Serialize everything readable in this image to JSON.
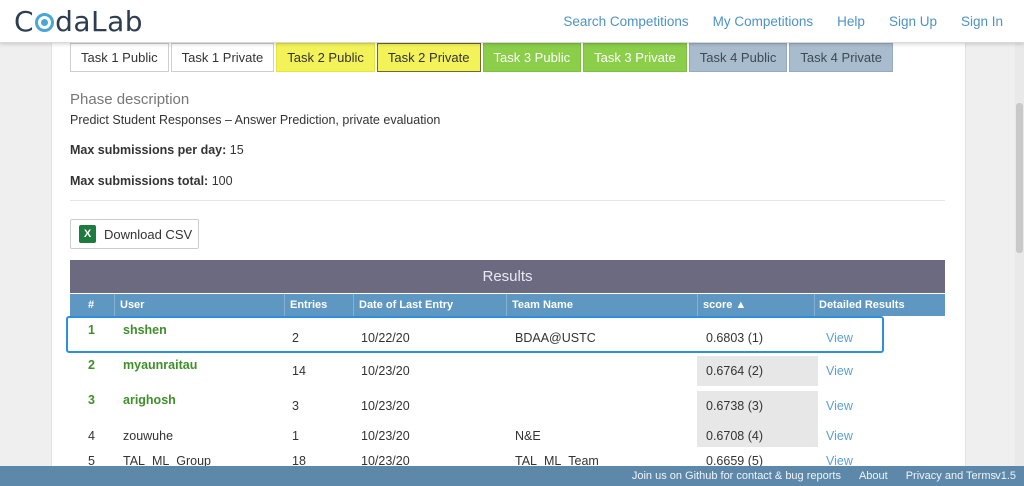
{
  "brand": {
    "name_prefix": "C",
    "name_suffix": "daLab"
  },
  "nav": [
    "Search Competitions",
    "My Competitions",
    "Help",
    "Sign Up",
    "Sign In"
  ],
  "tabs": [
    {
      "label": "Task 1 Public",
      "group": "t1"
    },
    {
      "label": "Task 1 Private",
      "group": "t1"
    },
    {
      "label": "Task 2 Public",
      "group": "t2"
    },
    {
      "label": "Task 2 Private",
      "group": "t2",
      "active": true
    },
    {
      "label": "Task 3 Public",
      "group": "t3"
    },
    {
      "label": "Task 3 Private",
      "group": "t3"
    },
    {
      "label": "Task 4 Public",
      "group": "t4"
    },
    {
      "label": "Task 4 Private",
      "group": "t4"
    }
  ],
  "phase": {
    "title": "Phase description",
    "description": "Predict Student Responses – Answer Prediction, private evaluation",
    "max_per_day_label": "Max submissions per day:",
    "max_per_day": "15",
    "max_total_label": "Max submissions total:",
    "max_total": "100"
  },
  "download": {
    "label": "Download CSV",
    "icon_letter": "X"
  },
  "results": {
    "title": "Results",
    "columns": [
      "#",
      "User",
      "Entries",
      "Date of Last Entry",
      "Team Name",
      "score ▲",
      "Detailed Results"
    ],
    "rows": [
      {
        "rank": "1",
        "user": "shshen",
        "entries": "2",
        "date": "10/22/20",
        "team": "BDAA@USTC",
        "score": "0.6803 (1)",
        "view": "View",
        "top": true
      },
      {
        "rank": "2",
        "user": "myaunraitau",
        "entries": "14",
        "date": "10/23/20",
        "team": "",
        "score": "0.6764 (2)",
        "view": "View",
        "top": true
      },
      {
        "rank": "3",
        "user": "arighosh",
        "entries": "3",
        "date": "10/23/20",
        "team": "",
        "score": "0.6738 (3)",
        "view": "View",
        "top": true
      },
      {
        "rank": "4",
        "user": "zouwuhe",
        "entries": "1",
        "date": "10/23/20",
        "team": "N&E",
        "score": "0.6708 (4)",
        "view": "View",
        "top": false
      },
      {
        "rank": "5",
        "user": "TAL_ML_Group",
        "entries": "18",
        "date": "10/23/20",
        "team": "TAL_ML_Team",
        "score": "0.6659 (5)",
        "view": "View",
        "top": false
      }
    ]
  },
  "footer": {
    "links": [
      "Join us on Github for contact & bug reports",
      "About",
      "Privacy and Terms"
    ],
    "version": "v1.5"
  },
  "colors": {
    "accent": "#4d93c4",
    "results_header": "#6b6a80",
    "column_header": "#5e97c2",
    "top_rank": "#3f8f2a",
    "highlight": "#2e8fe0"
  }
}
